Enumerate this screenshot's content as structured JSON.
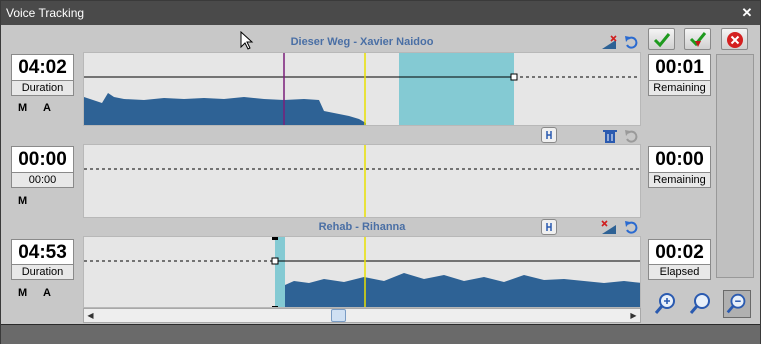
{
  "window": {
    "title": "Voice Tracking"
  },
  "track1": {
    "title": "Dieser Weg - Xavier Naidoo",
    "time": "04:02",
    "time_label": "Duration",
    "right_time": "00:01",
    "right_label": "Remaining",
    "m": "M",
    "a": "A"
  },
  "voice": {
    "time": "00:00",
    "time_label": "00:00",
    "right_time": "00:00",
    "right_label": "Remaining",
    "m": "M"
  },
  "track2": {
    "title": "Rehab - Rihanna",
    "time": "04:53",
    "time_label": "Duration",
    "right_time": "00:02",
    "right_label": "Elapsed",
    "m": "M",
    "a": "A"
  },
  "colors": {
    "waveform": "#2e6295",
    "highlight": "#84cad3",
    "cursor_line": "#e8e000",
    "marker_line": "#7a1f7a",
    "title_text": "#4a6fa5"
  },
  "icons": {
    "accept": "checkmark-icon",
    "accept_down": "checkmark-down-icon",
    "cancel": "cancel-icon",
    "zoom_in": "zoom-in-icon",
    "zoom_reset": "zoom-icon",
    "zoom_out": "zoom-out-icon"
  }
}
